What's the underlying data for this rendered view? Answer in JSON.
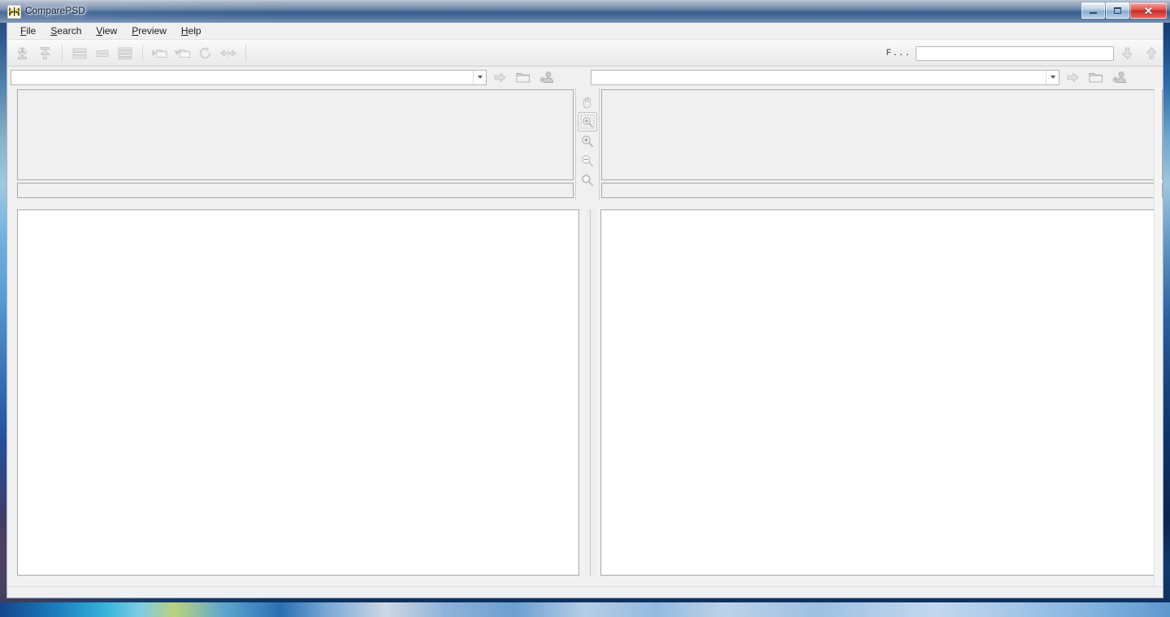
{
  "window": {
    "title": "ComparePSD",
    "icon": "butterfly-app-icon",
    "controls": {
      "minimize": "Minimize",
      "maximize": "Maximize",
      "close": "Close"
    }
  },
  "menubar": {
    "items": [
      {
        "label": "File",
        "accesskey": "F",
        "name": "menu-file"
      },
      {
        "label": "Search",
        "accesskey": "S",
        "name": "menu-search"
      },
      {
        "label": "View",
        "accesskey": "V",
        "name": "menu-view"
      },
      {
        "label": "Preview",
        "accesskey": "P",
        "name": "menu-preview"
      },
      {
        "label": "Help",
        "accesskey": "H",
        "name": "menu-help"
      }
    ]
  },
  "toolbar": {
    "groups": [
      {
        "buttons": [
          {
            "icon": "download-arrow-icon",
            "label": "Load",
            "enabled": false
          },
          {
            "icon": "upload-arrow-icon",
            "label": "Save",
            "enabled": false
          }
        ]
      },
      {
        "buttons": [
          {
            "icon": "list-view-detail-icon",
            "label": "Detail View",
            "enabled": false
          },
          {
            "icon": "list-view-compact-icon",
            "label": "Compact View",
            "enabled": false
          },
          {
            "icon": "list-view-full-icon",
            "label": "Full View",
            "enabled": false
          }
        ]
      },
      {
        "buttons": [
          {
            "icon": "folder-expand-icon",
            "label": "Expand Folder",
            "enabled": false
          },
          {
            "icon": "folder-collapse-icon",
            "label": "Collapse Folder",
            "enabled": false
          },
          {
            "icon": "refresh-icon",
            "label": "Refresh",
            "enabled": false
          },
          {
            "icon": "swap-sides-icon",
            "label": "Swap Sides",
            "enabled": false
          }
        ]
      }
    ],
    "find": {
      "label": "F...",
      "value": "",
      "placeholder": "",
      "prev_icon": "find-down-arrow-icon",
      "next_icon": "find-up-arrow-icon"
    }
  },
  "paths": {
    "left": {
      "value": "",
      "placeholder": "",
      "dropdown_icon": "chevron-down-icon",
      "go_icon": "go-arrow-icon",
      "browse_icon": "folder-icon",
      "user_icon": "user-browse-icon"
    },
    "right": {
      "value": "",
      "placeholder": "",
      "dropdown_icon": "chevron-down-icon",
      "go_icon": "go-arrow-icon",
      "browse_icon": "folder-icon",
      "user_icon": "user-browse-icon"
    }
  },
  "preview": {
    "left": {
      "info": ""
    },
    "right": {
      "info": ""
    },
    "zoom_tools": [
      {
        "icon": "hand-pan-icon",
        "label": "Pan",
        "active": false
      },
      {
        "icon": "zoom-selection-icon",
        "label": "Zoom Selection",
        "active": true
      },
      {
        "icon": "zoom-in-icon",
        "label": "Zoom In",
        "active": false
      },
      {
        "icon": "zoom-out-icon",
        "label": "Zoom Out",
        "active": false
      },
      {
        "icon": "zoom-fit-icon",
        "label": "Fit to Window",
        "active": false
      }
    ]
  },
  "lists": {
    "left": {
      "items": []
    },
    "right": {
      "items": []
    }
  },
  "statusbar": {
    "text": ""
  },
  "colors": {
    "window_face": "#f0f0f0",
    "pane_background": "#ffffff",
    "border": "#a8a8a8",
    "close_button": "#c92b26",
    "aero_glass": "#9fc6e0"
  }
}
